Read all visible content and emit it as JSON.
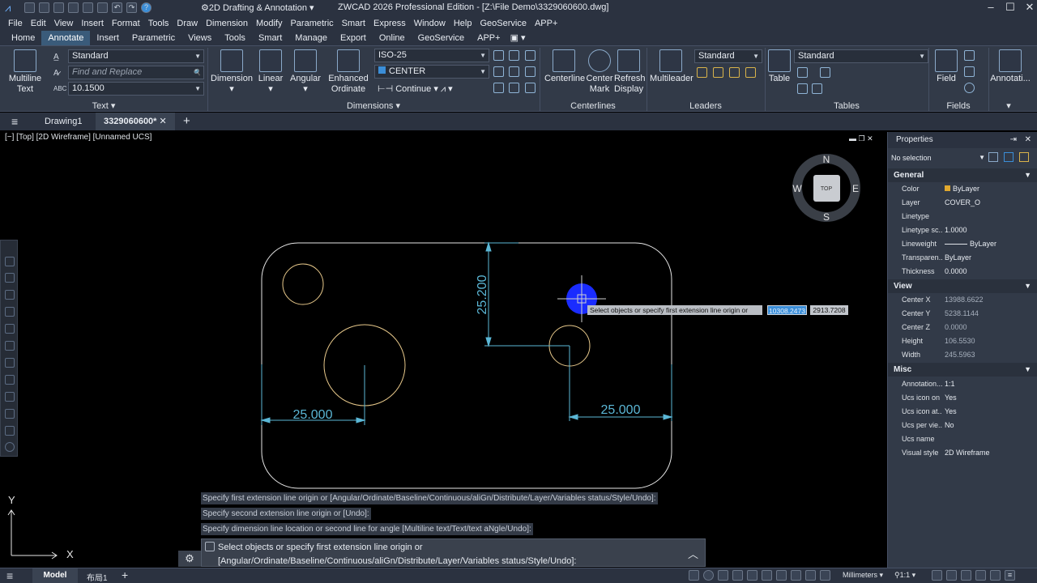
{
  "app": {
    "title": "ZWCAD 2026 Professional Edition - [Z:\\File Demo\\3329060600.dwg]",
    "workspace": "2D Drafting & Annotation"
  },
  "menu": [
    "File",
    "Edit",
    "View",
    "Insert",
    "Format",
    "Tools",
    "Draw",
    "Dimension",
    "Modify",
    "Parametric",
    "Smart",
    "Express",
    "Window",
    "Help",
    "GeoService",
    "APP+"
  ],
  "ribbon_tabs": [
    "Home",
    "Annotate",
    "Insert",
    "Parametric",
    "Views",
    "Tools",
    "Smart",
    "Manage",
    "Export",
    "Online",
    "GeoService",
    "APP+"
  ],
  "ribbon_active_tab": "Annotate",
  "ribbon": {
    "text_panel": {
      "title": "Text",
      "big_button": "Multiline Text",
      "style_value": "Standard",
      "find_placeholder": "Find and Replace",
      "height_value": "10.1500"
    },
    "dimensions_panel": {
      "title": "Dimensions",
      "buttons": [
        "Dimension",
        "Linear",
        "Angular",
        "Enhanced Ordinate"
      ],
      "dimstyle": "ISO-25",
      "layer": "CENTER",
      "continue": "Continue"
    },
    "centerlines_panel": {
      "title": "Centerlines",
      "buttons": [
        "Centerline",
        "Center Mark",
        "Refresh Display"
      ]
    },
    "leaders_panel": {
      "title": "Leaders",
      "big_button": "Multileader",
      "style_value": "Standard"
    },
    "tables_panel": {
      "title": "Tables",
      "big_button": "Table",
      "style_value": "Standard"
    },
    "fields_panel": {
      "title": "Fields",
      "big_button": "Field"
    },
    "annot_panel": {
      "big_button": "Annotati..."
    }
  },
  "doc_tabs": {
    "menu_icon": "≡",
    "tabs": [
      "Drawing1",
      "3329060600*"
    ],
    "active": "3329060600*",
    "add": "+"
  },
  "viewport": {
    "label": "[−] [Top] [2D Wireframe]  [Unnamed UCS]"
  },
  "viewcube": {
    "n": "N",
    "s": "S",
    "e": "E",
    "w": "W",
    "face": "TOP"
  },
  "drawing": {
    "dims": [
      "25.000",
      "25.000",
      "25.200"
    ],
    "tooltip": "Select objects or specify first extension line origin or",
    "x_input": "10308.2473",
    "y_input": "2913.7208",
    "ucs_x": "X",
    "ucs_y": "Y"
  },
  "command_history": [
    "Specify first extension line origin or [Angular/Ordinate/Baseline/Continuous/aliGn/Distribute/Layer/Variables status/Style/Undo]:",
    "Specify second extension line origin or [Undo]:",
    "Specify dimension line location or second line for angle [Multiline text/Text/text aNgle/Undo]:"
  ],
  "command_line": {
    "prompt": "Select objects or specify first extension line origin or [Angular/Ordinate/Baseline/Continuous/aliGn/Distribute/Layer/Variables status/Style/Undo]:"
  },
  "properties": {
    "title": "Properties",
    "selection": "No selection",
    "sections": [
      {
        "name": "General",
        "rows": [
          [
            "Color",
            "ByLayer"
          ],
          [
            "Layer",
            "COVER_O"
          ],
          [
            "Linetype",
            ""
          ],
          [
            "Linetype sc...",
            "1.0000"
          ],
          [
            "Lineweight",
            "ByLayer"
          ],
          [
            "Transparen...",
            "ByLayer"
          ],
          [
            "Thickness",
            "0.0000"
          ]
        ]
      },
      {
        "name": "View",
        "rows": [
          [
            "Center X",
            "13988.6622"
          ],
          [
            "Center Y",
            "5238.1144"
          ],
          [
            "Center Z",
            "0.0000"
          ],
          [
            "Height",
            "106.5530"
          ],
          [
            "Width",
            "245.5963"
          ]
        ]
      },
      {
        "name": "Misc",
        "rows": [
          [
            "Annotation...",
            "1:1"
          ],
          [
            "Ucs icon on",
            "Yes"
          ],
          [
            "Ucs icon at...",
            "Yes"
          ],
          [
            "Ucs per vie...",
            "No"
          ],
          [
            "Ucs name",
            ""
          ],
          [
            "Visual style",
            "2D Wireframe"
          ]
        ]
      }
    ]
  },
  "statusbar": {
    "tabs": [
      "Model",
      "布局1"
    ],
    "add": "+",
    "units": "Millimeters",
    "scale": "1:1"
  },
  "colors": {
    "bg": "#000000",
    "dim": "#5bb7d6",
    "geometry": "#e8c98b",
    "outline": "#e6e6e6",
    "accent": "#3b8ed8"
  }
}
